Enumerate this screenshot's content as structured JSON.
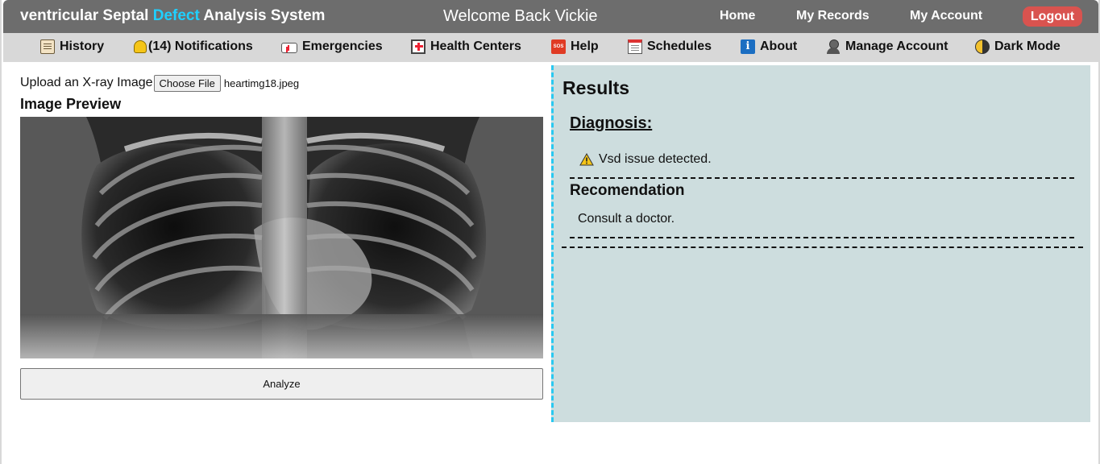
{
  "header": {
    "brand_part1": "ventricular Septal ",
    "brand_accent": "Defect",
    "brand_part2": " Analysis System",
    "welcome": "Welcome Back Vickie",
    "nav": {
      "home": "Home",
      "records": "My Records",
      "account": "My Account",
      "logout": "Logout"
    }
  },
  "subnav": {
    "items": [
      {
        "label": "History",
        "icon": "scroll-icon"
      },
      {
        "label": "(14) Notifications",
        "icon": "bell-icon"
      },
      {
        "label": "Emergencies",
        "icon": "ambulance-icon"
      },
      {
        "label": "Health Centers",
        "icon": "hospital-icon"
      },
      {
        "label": "Help",
        "icon": "sos-icon"
      },
      {
        "label": "Schedules",
        "icon": "calendar-icon"
      },
      {
        "label": "About",
        "icon": "info-icon"
      },
      {
        "label": "Manage Account",
        "icon": "person-icon"
      },
      {
        "label": "Dark Mode",
        "icon": "half-moon-icon"
      }
    ],
    "sos_text": "SOS"
  },
  "upload": {
    "label": "Upload an X-ray Image",
    "button": "Choose File",
    "filename": "heartimg18.jpeg",
    "preview_title": "Image Preview",
    "analyze": "Analyze"
  },
  "results": {
    "title": "Results",
    "diagnosis_title": "Diagnosis:",
    "diagnosis_text": "Vsd issue detected.",
    "recommendation_title": "Recomendation",
    "recommendation_text": "Consult a doctor."
  },
  "colors": {
    "accent": "#1fd0ff",
    "logout": "#d9534f",
    "results_bg": "#cdddde",
    "divider": "#29c8f0"
  }
}
